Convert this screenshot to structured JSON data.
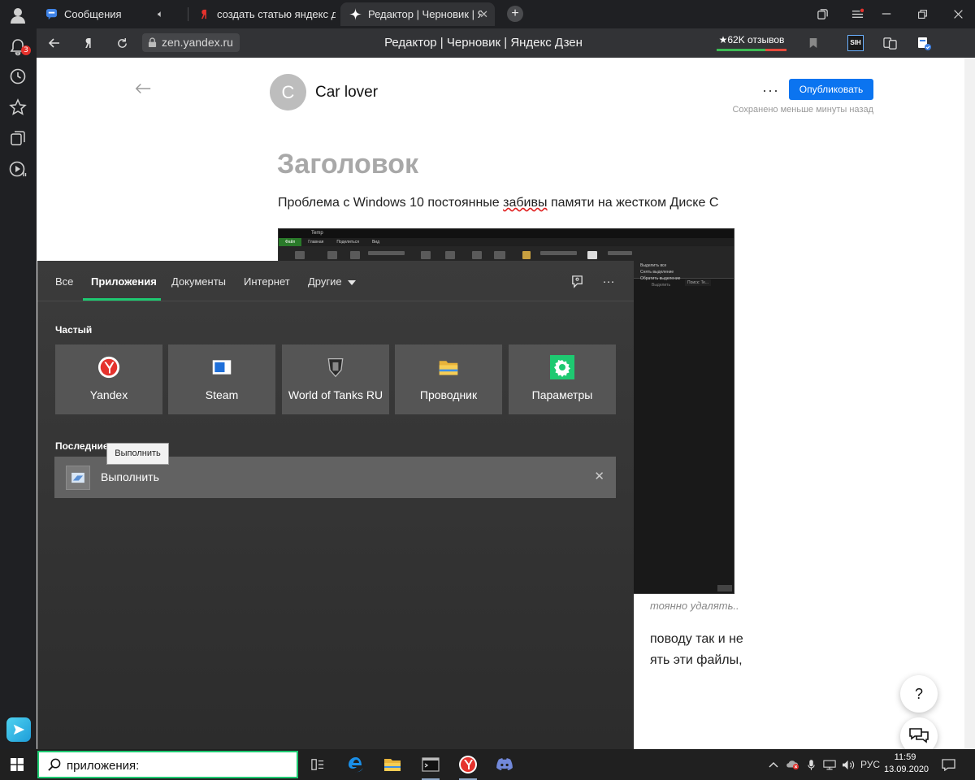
{
  "browser": {
    "tabs": [
      {
        "title": "Сообщения",
        "sound": true
      },
      {
        "title": "создать статью яндекс дзен"
      },
      {
        "title": "Редактор | Черновик | Я",
        "close": "✕"
      }
    ],
    "new_tab": "+",
    "url": "zen.yandex.ru",
    "page_title": "Редактор | Черновик | Яндекс Дзен",
    "reviews": "★62K отзывов",
    "notification_count": "3",
    "extension_label": "SIH"
  },
  "editor": {
    "avatar_letter": "C",
    "author": "Car lover",
    "more": "···",
    "publish": "Опубликовать",
    "saved_status": "Сохранено меньше минуты назад",
    "title": "Заголовок",
    "line1_a": "Проблема с Windows 10  постоянные ",
    "line1_b": "забивы",
    "line1_c": " памяти на жестком Диске С",
    "caption_tail": "тоянно удалять..",
    "tail1": "поводу так и не",
    "tail2": "ять эти файлы,",
    "help": "?",
    "embedded": {
      "title": "Temp",
      "tabs": [
        "Файл",
        "Главная",
        "Поделиться",
        "Вид"
      ],
      "ribbon_labels": [
        "Выделить все",
        "Снять выделение",
        "Обратить выделение",
        "Выделить"
      ],
      "search_placeholder": "Поиск: Te..."
    }
  },
  "search": {
    "tabs": [
      "Все",
      "Приложения",
      "Документы",
      "Интернет",
      "Другие"
    ],
    "frequent_label": "Частый",
    "apps": [
      "Yandex",
      "Steam",
      "World of Tanks RU",
      "Проводник",
      "Параметры"
    ],
    "recent_label": "Последние",
    "tooltip": "Выполнить",
    "recent_item": "Выполнить",
    "remove": "✕"
  },
  "taskbar": {
    "search_value": "приложения:",
    "language": "РУС",
    "time": "11:59",
    "date": "13.09.2020"
  },
  "colors": {
    "accent_green": "#1ec971",
    "publish_blue": "#0b74f0",
    "badge_red": "#e5322d"
  }
}
